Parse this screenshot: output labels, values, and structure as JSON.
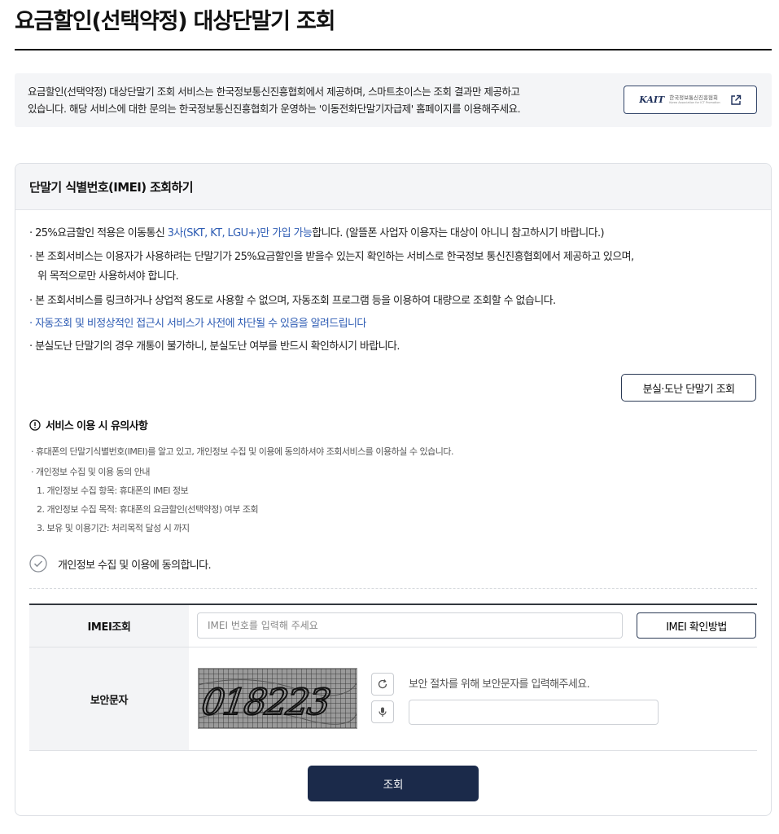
{
  "page": {
    "title": "요금할인(선택약정) 대상단말기 조회"
  },
  "info": {
    "line1": "요금할인(선택약정) 대상단말기 조회 서비스는 한국정보통신진흥협회에서 제공하며, 스마트초이스는 조회 결과만 제공하고",
    "line2": "있습니다. 해당 서비스에 대한 문의는 한국정보통신진흥협회가 운영하는 '이동전화단말기자급제' 홈페이지를 이용해주세요.",
    "kait_logo": "KAIT",
    "kait_name": "한국정보통신진흥협회",
    "kait_name_en": "Korea Association for ICT Promotion",
    "external_icon": "external-link-icon"
  },
  "panel": {
    "title": "단말기 식별번호(IMEI) 조회하기",
    "notices": {
      "n1_pre": "· 25%요금할인 적용은 이동통신 ",
      "n1_blue": "3사(SKT, KT, LGU+)만 가입 가능",
      "n1_post": "합니다. (알뜰폰 사업자 이용자는 대상이 아니니 참고하시기 바랍니다.)",
      "n2_line1": "· 본 조회서비스는 이용자가 사용하려는 단말기가 25%요금할인을 받을수 있는지 확인하는 서비스로 한국정보 통신진흥협회에서 제공하고 있으며,",
      "n2_line2": "위 목적으로만 사용하셔야 합니다.",
      "n3": "· 본 조회서비스를 링크하거나 상업적 용도로 사용할 수 없으며, 자동조회 프로그램 등을 이용하여 대량으로 조회할 수 없습니다.",
      "n4": "· 자동조회 및 비정상적인 접근시 서비스가 사전에 차단될 수 있음을 알려드립니다",
      "n5": "· 분실도난 단말기의 경우 개통이 불가하니, 분실도난 여부를 반드시 확인하시기 바랍니다."
    },
    "lost_button": "분실·도난 단말기 조회",
    "caution": {
      "icon": "info-circle-icon",
      "title": "서비스 이용 시 유의사항",
      "items": [
        "· 휴대폰의 단말기식별번호(IMEI)를 알고 있고, 개인정보 수집 및 이용에 동의하셔야 조회서비스를 이용하실 수 있습니다.",
        "· 개인정보 수집 및 이용 동의 안내",
        "1. 개인정보 수집 항목: 휴대폰의 IMEI 정보",
        "2. 개인정보 수집 목적: 휴대폰의 요금할인(선택약정) 여부 조회",
        "3. 보유 및 이용기간: 처리목적 달성 시 까지"
      ]
    },
    "agree": {
      "icon": "check-circle-icon",
      "label": "개인정보 수집 및 이용에 동의합니다."
    },
    "form": {
      "imei_label": "IMEI조회",
      "imei_placeholder": "IMEI 번호를 입력해 주세요",
      "imei_value": "",
      "imei_help_button": "IMEI 확인방법",
      "captcha_label": "보안문자",
      "captcha_text": "018223",
      "refresh_icon": "refresh-icon",
      "audio_icon": "microphone-icon",
      "captcha_hint": "보안 절차를 위해 보안문자를 입력해주세요.",
      "captcha_value": ""
    },
    "submit_button": "조회"
  }
}
